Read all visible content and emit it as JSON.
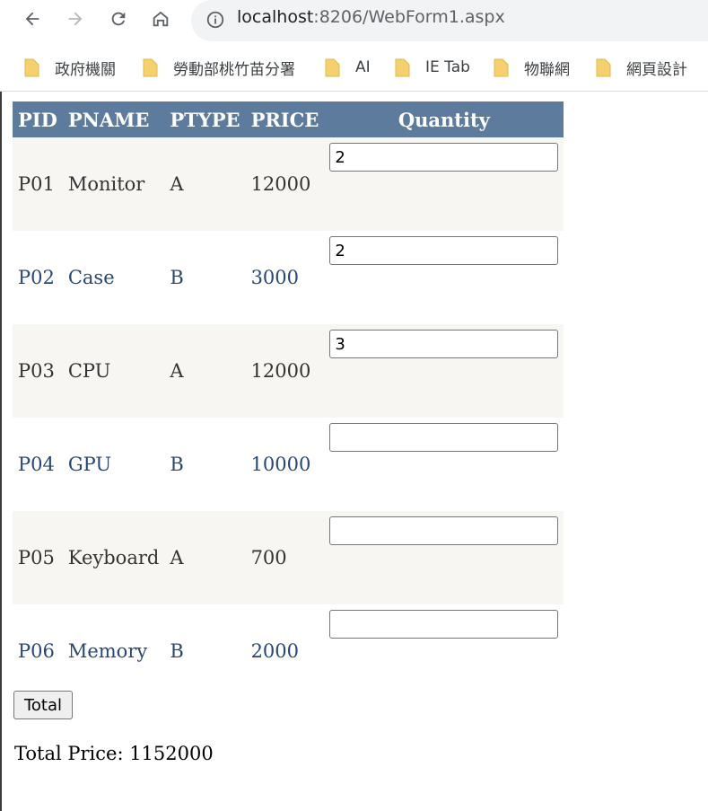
{
  "browser": {
    "url_host": "localhost",
    "url_rest": ":8206/WebForm1.aspx",
    "bookmarks": [
      "政府機關",
      "勞動部桃竹苗分署",
      "AI",
      "IE Tab",
      "物聯網",
      "網頁設計"
    ]
  },
  "grid": {
    "headers": [
      "PID",
      "PNAME",
      "PTYPE",
      "PRICE",
      "Quantity"
    ],
    "rows": [
      {
        "pid": "P01",
        "pname": "Monitor",
        "ptype": "A",
        "price": "12000",
        "qty": "2"
      },
      {
        "pid": "P02",
        "pname": "Case",
        "ptype": "B",
        "price": "3000",
        "qty": "2"
      },
      {
        "pid": "P03",
        "pname": "CPU",
        "ptype": "A",
        "price": "12000",
        "qty": "3"
      },
      {
        "pid": "P04",
        "pname": "GPU",
        "ptype": "B",
        "price": "10000",
        "qty": ""
      },
      {
        "pid": "P05",
        "pname": "Keyboard",
        "ptype": "A",
        "price": "700",
        "qty": ""
      },
      {
        "pid": "P06",
        "pname": "Memory",
        "ptype": "B",
        "price": "2000",
        "qty": ""
      }
    ]
  },
  "total_button_label": "Total",
  "total_text": "Total Price: 1152000",
  "colors": {
    "header_bg": "#5d7b9d",
    "odd_row_bg": "#f7f6f3",
    "odd_row_text": "#333333",
    "even_row_text": "#284775"
  },
  "icons": [
    "back-icon",
    "forward-icon",
    "reload-icon",
    "home-icon",
    "info-icon",
    "folder-icon"
  ]
}
